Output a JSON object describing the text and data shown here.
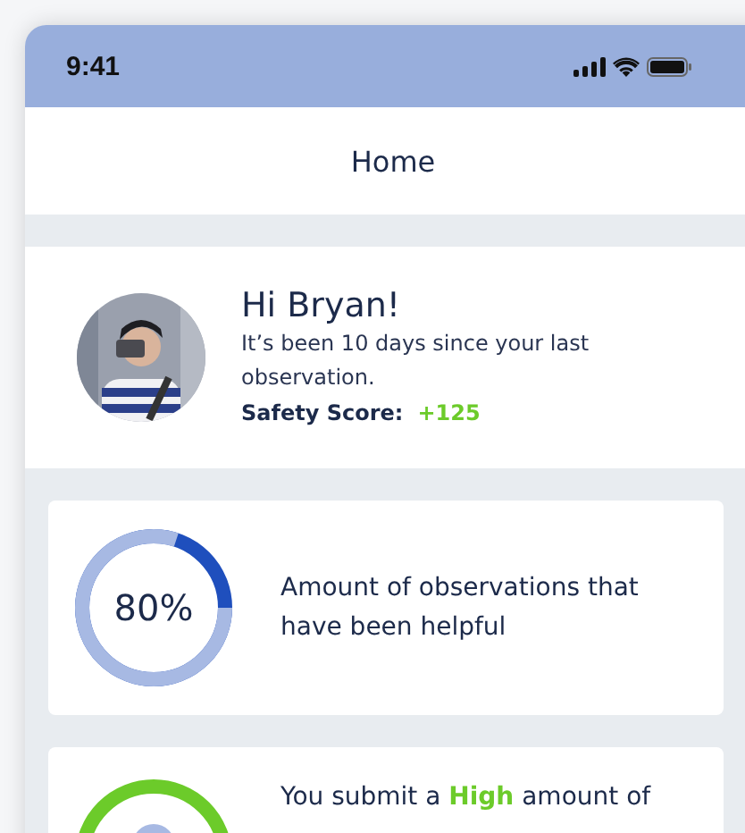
{
  "status_bar": {
    "time": "9:41"
  },
  "header": {
    "title": "Home"
  },
  "profile": {
    "kind": "picture",
    "greeting": "Hi Bryan!",
    "message": "It’s been 10 days since your last observation.",
    "score_label": "Safety Score:",
    "score_value": "+125"
  },
  "cards": [
    {
      "kind": "percent",
      "level": 0.8,
      "value": "80%",
      "text": "Amount of observations that have been helpful"
    },
    {
      "kind": "rating",
      "text_before": "You submit a",
      "highlight": "High",
      "text_after": "amount of"
    }
  ]
}
